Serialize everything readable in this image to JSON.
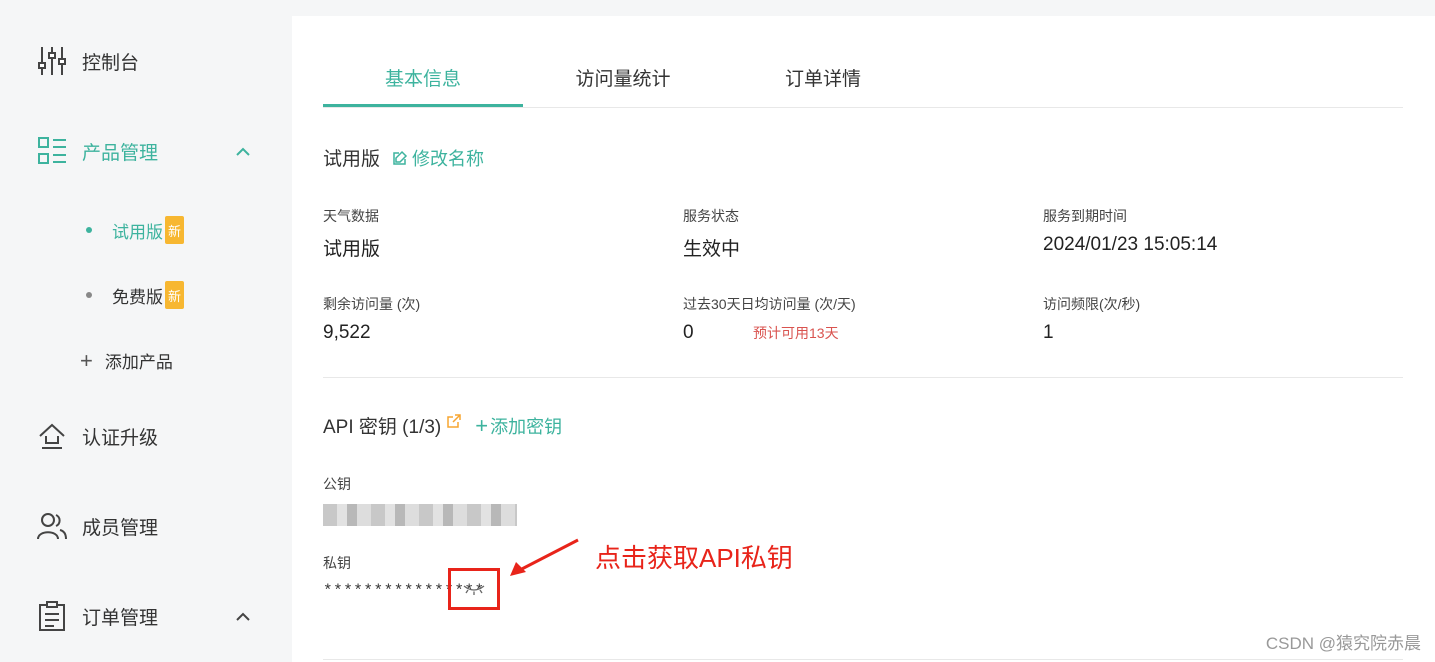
{
  "sidebar": {
    "console": "控制台",
    "product_mgmt": "产品管理",
    "products": [
      {
        "label": "试用版",
        "badge": "新"
      },
      {
        "label": "免费版",
        "badge": "新"
      }
    ],
    "add_product": "添加产品",
    "upgrade": "认证升级",
    "members": "成员管理",
    "orders": "订单管理"
  },
  "tabs": [
    "基本信息",
    "访问量统计",
    "订单详情"
  ],
  "plan": {
    "title": "试用版",
    "rename": "修改名称"
  },
  "info": {
    "weather_label": "天气数据",
    "weather_value": "试用版",
    "status_label": "服务状态",
    "status_value": "生效中",
    "expiry_label": "服务到期时间",
    "expiry_value": "2024/01/23 15:05:14",
    "remaining_label": "剩余访问量 (次)",
    "remaining_value": "9,522",
    "avg_label": "过去30天日均访问量 (次/天)",
    "avg_value": "0",
    "avg_hint": "预计可用13天",
    "rate_label": "访问频限(次/秒)",
    "rate_value": "1"
  },
  "api": {
    "title": "API 密钥 (1/3)",
    "add_key": "添加密钥",
    "public_label": "公钥",
    "private_label": "私钥",
    "private_value": "****************"
  },
  "annotation": "点击获取API私钥",
  "watermark": "CSDN @猿究院赤晨",
  "colors": {
    "accent": "#3db39e",
    "badge": "#f7b731",
    "annotation": "#e8241a",
    "hint": "#d9534f"
  }
}
